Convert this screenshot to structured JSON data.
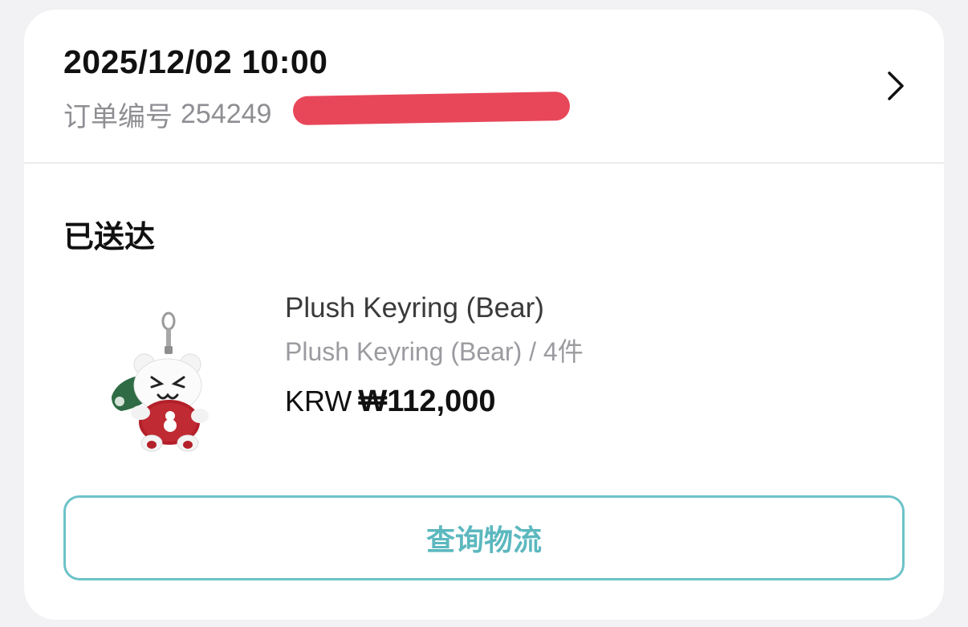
{
  "order": {
    "datetime": "2025/12/02 10:00",
    "number_label": "订单编号",
    "number_value": "254249"
  },
  "status": "已送达",
  "product": {
    "name": "Plush Keyring (Bear)",
    "variant": "Plush Keyring (Bear) / 4件",
    "price_currency": "KRW",
    "price_amount": "₩112,000"
  },
  "actions": {
    "track_label": "查询物流"
  },
  "icons": {
    "chevron": "chevron-right-icon"
  },
  "colors": {
    "accent": "#5cb8bf",
    "redaction": "#e8475a"
  }
}
